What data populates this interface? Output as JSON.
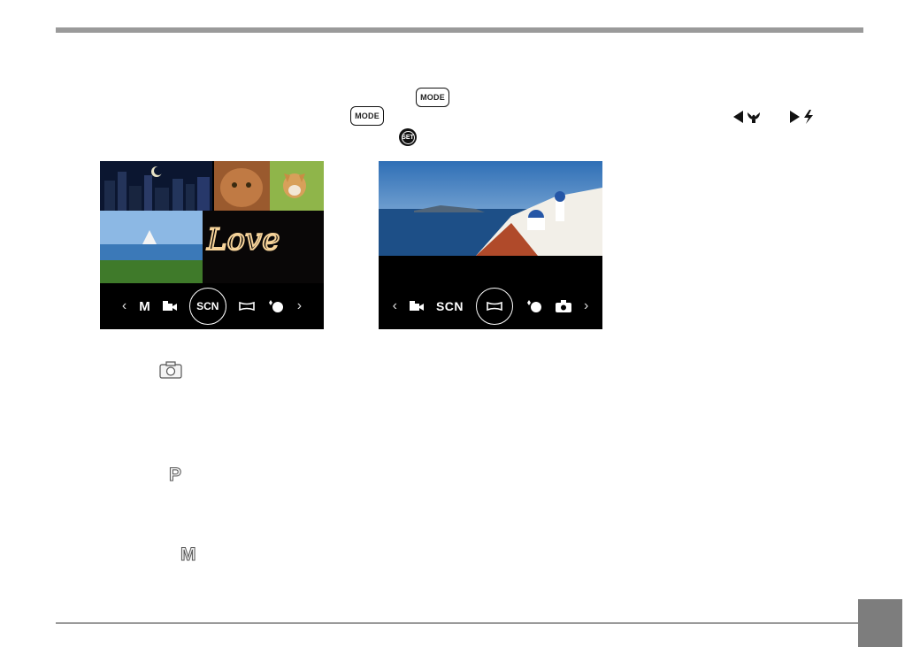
{
  "header": {
    "rule_color": "#9a9a9a"
  },
  "instructions": {
    "mode_button_label": "MODE",
    "mode_button_label_2": "MODE",
    "set_button_label": "SET"
  },
  "screens": [
    {
      "mode_bar": {
        "left_chevron": "‹",
        "items": [
          "M",
          "SCN"
        ],
        "selected": "SCN",
        "right_chevron": "›"
      }
    },
    {
      "mode_bar": {
        "left_chevron": "‹",
        "items": [
          "SCN"
        ],
        "right_chevron": "›"
      }
    }
  ],
  "mode_list": [
    {
      "icon": "camera-icon"
    },
    {
      "icon": "program-p-icon",
      "glyph": "P"
    },
    {
      "icon": "manual-m-icon",
      "glyph": "M"
    }
  ],
  "footer": {
    "page_tab_color": "#7d7d7d"
  }
}
